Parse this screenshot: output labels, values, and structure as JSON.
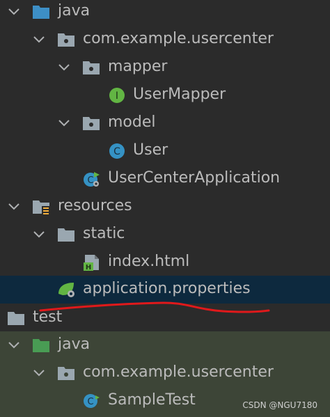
{
  "tree": {
    "items": [
      {
        "label": "java",
        "icon": "source-folder-icon",
        "expanded": true
      },
      {
        "label": "com.example.usercenter",
        "icon": "package-icon",
        "expanded": true
      },
      {
        "label": "mapper",
        "icon": "package-icon",
        "expanded": true
      },
      {
        "label": "UserMapper",
        "icon": "interface-icon",
        "glyph": "I"
      },
      {
        "label": "model",
        "icon": "package-icon",
        "expanded": true
      },
      {
        "label": "User",
        "icon": "class-icon",
        "glyph": "C"
      },
      {
        "label": "UserCenterApplication",
        "icon": "spring-boot-class-icon",
        "glyph": "C"
      },
      {
        "label": "resources",
        "icon": "resources-folder-icon",
        "expanded": true
      },
      {
        "label": "static",
        "icon": "folder-icon",
        "expanded": true
      },
      {
        "label": "index.html",
        "icon": "html-file-icon",
        "glyph": "H"
      },
      {
        "label": "application.properties",
        "icon": "spring-properties-icon",
        "selected": true
      },
      {
        "label": "test",
        "icon": "folder-icon"
      },
      {
        "label": "java",
        "icon": "test-source-folder-icon",
        "expanded": true
      },
      {
        "label": "com.example.usercenter",
        "icon": "package-icon",
        "expanded": true
      },
      {
        "label": "SampleTest",
        "icon": "test-class-icon",
        "glyph": "C"
      }
    ]
  },
  "colors": {
    "background": "#2b2b2b",
    "selection": "#0d293e",
    "test_background": "#3d4537",
    "text": "#bbbbbb",
    "source_folder": "#3d8fc6",
    "test_folder": "#499c54",
    "annotation_underline": "#e0191b"
  },
  "watermark": "CSDN @NGU7180"
}
